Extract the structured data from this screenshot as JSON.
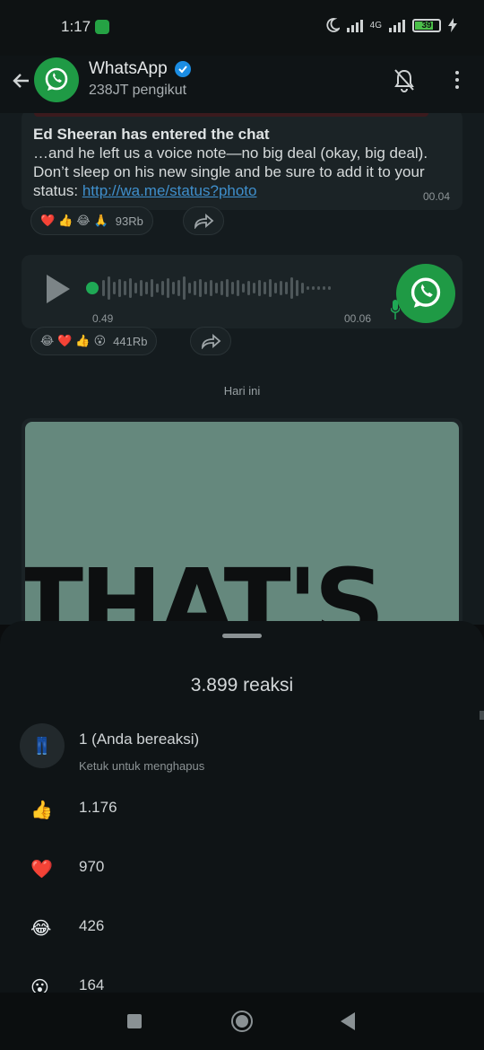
{
  "status_bar": {
    "time": "1:17",
    "network": "4G",
    "battery": "39"
  },
  "header": {
    "title": "WhatsApp",
    "subtitle": "238JT pengikut"
  },
  "messages": {
    "m1": {
      "headline": "Ed Sheeran has entered the chat",
      "body": "…and he left us a voice note—no big deal (okay, big deal). Don’t sleep on his new single and be sure to add it to your status: ",
      "link": "http://wa.me/status?photo",
      "time": "00.04",
      "reactions": [
        "❤️",
        "👍",
        "😂",
        "🙏"
      ],
      "reaction_count": "93Rb"
    },
    "m2": {
      "progress": "0.49",
      "duration": "00.06",
      "reactions": [
        "😂",
        "❤️",
        "👍",
        "😮"
      ],
      "reaction_count": "441Rb"
    },
    "day_label": "Hari ini",
    "m3": {
      "poster_text": "THAT'S"
    }
  },
  "sheet": {
    "title": "3.899 reaksi",
    "me": {
      "emoji": "👖",
      "label": "1 (Anda bereaksi)",
      "hint": "Ketuk untuk menghapus"
    },
    "rows": [
      {
        "emoji": "👍",
        "count": "1.176"
      },
      {
        "emoji": "❤️",
        "count": "970"
      },
      {
        "emoji": "😂",
        "count": "426"
      },
      {
        "emoji": "😮",
        "count": "164"
      }
    ]
  },
  "colors": {
    "accent": "#1fa855",
    "link": "#3f8fcc",
    "verified": "#1b8de3"
  }
}
